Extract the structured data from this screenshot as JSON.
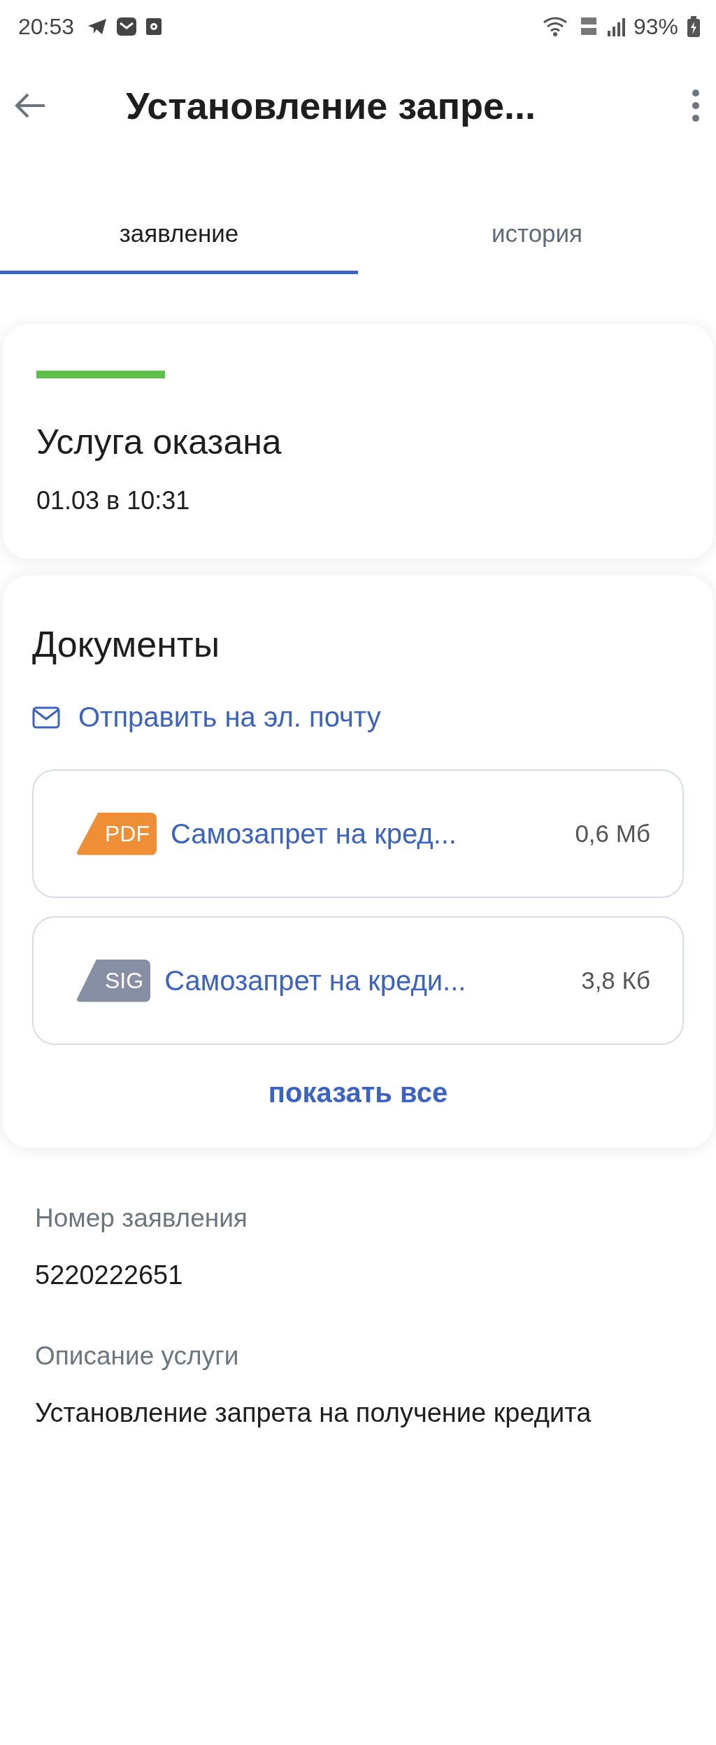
{
  "status_bar": {
    "time": "20:53",
    "battery": "93%"
  },
  "header": {
    "title": "Установление запре..."
  },
  "tabs": [
    {
      "label": "заявление",
      "selected": true
    },
    {
      "label": "история",
      "selected": false
    }
  ],
  "status_card": {
    "title": "Услуга оказана",
    "date": "01.03 в 10:31"
  },
  "documents": {
    "title": "Документы",
    "email_link": "Отправить на эл. почту",
    "files": [
      {
        "format": "PDF",
        "color": "#ee8f35",
        "name": "Самозапрет на кред...",
        "size": "0,6 Мб"
      },
      {
        "format": "SIG",
        "color": "#878fa5",
        "name": "Самозапрет на креди...",
        "size": "3,8 Кб"
      }
    ],
    "show_all": "показать все"
  },
  "details": [
    {
      "label": "Номер заявления",
      "value": "5220222651"
    },
    {
      "label": "Описание услуги",
      "value": "Установление запрета на получение кредита"
    }
  ]
}
